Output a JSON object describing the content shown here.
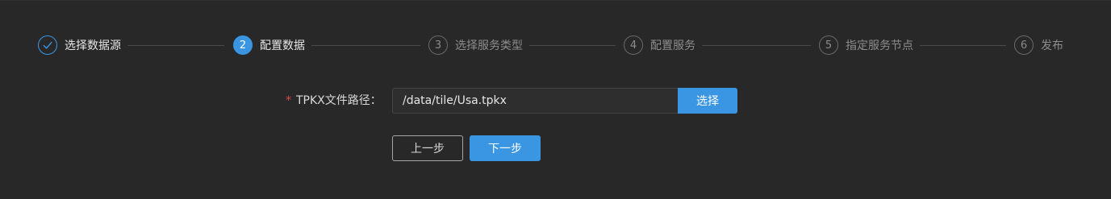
{
  "steps": [
    {
      "number": "",
      "title": "选择数据源",
      "status": "done",
      "icon": "check-icon"
    },
    {
      "number": "2",
      "title": "配置数据",
      "status": "active"
    },
    {
      "number": "3",
      "title": "选择服务类型",
      "status": "pending"
    },
    {
      "number": "4",
      "title": "配置服务",
      "status": "pending"
    },
    {
      "number": "5",
      "title": "指定服务节点",
      "status": "pending"
    },
    {
      "number": "6",
      "title": "发布",
      "status": "pending"
    }
  ],
  "form": {
    "required_mark": "*",
    "path_label": "TPKX文件路径：",
    "path_value": "/data/tile/Usa.tpkx",
    "choose_button": "选择"
  },
  "actions": {
    "prev_label": "上一步",
    "next_label": "下一步"
  },
  "colors": {
    "background": "#282828",
    "accent": "#3a96e2",
    "required": "#e84749"
  }
}
